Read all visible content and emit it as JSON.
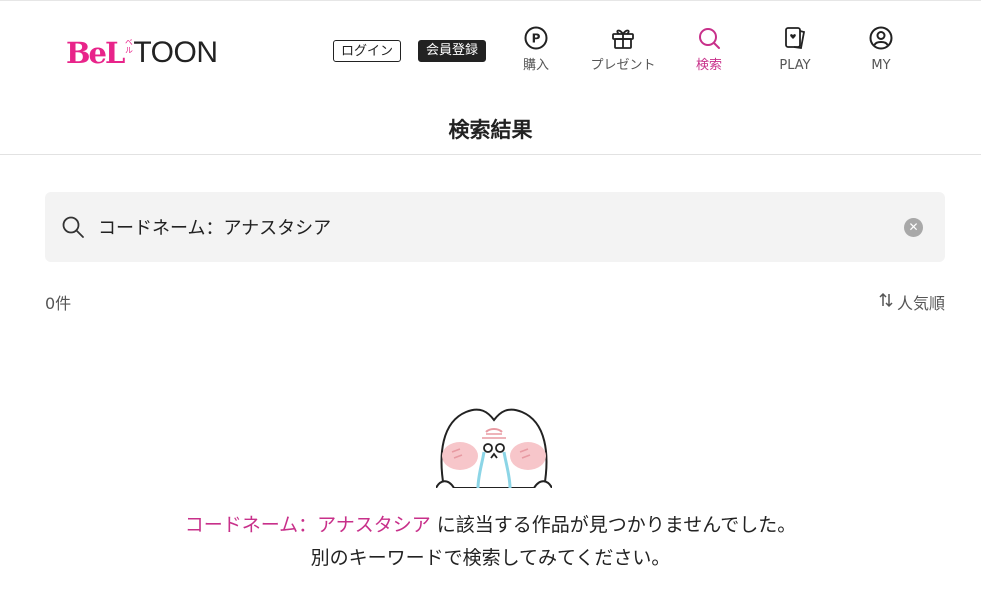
{
  "header": {
    "logo": {
      "bel": "BeL",
      "belu": "ベル",
      "toon": "TOON"
    },
    "login_label": "ログイン",
    "register_label": "会員登録",
    "nav": [
      {
        "label": "購入",
        "icon": "point-coin-icon",
        "active": false
      },
      {
        "label": "プレゼント",
        "icon": "gift-icon",
        "active": false
      },
      {
        "label": "検索",
        "icon": "search-icon",
        "active": true
      },
      {
        "label": "PLAY",
        "icon": "cards-icon",
        "active": false
      },
      {
        "label": "MY",
        "icon": "user-icon",
        "active": false
      }
    ]
  },
  "page": {
    "title": "検索結果"
  },
  "search": {
    "value": "コードネーム：アナスタシア",
    "clear_icon": "clear-icon"
  },
  "results": {
    "count_label": "0件",
    "sort_label": "人気順",
    "sort_icon": "sort-arrows-icon"
  },
  "empty_state": {
    "mascot_icon": "crying-mascot-icon",
    "keyword": "コードネーム：アナスタシア",
    "line1_suffix": " に該当する作品が見つかりませんでした。",
    "line2": "別のキーワードで検索してみてください。"
  },
  "colors": {
    "brand_pink": "#e8248a",
    "accent": "#c8308a",
    "text": "#222222",
    "search_bg": "#f3f3f3"
  }
}
